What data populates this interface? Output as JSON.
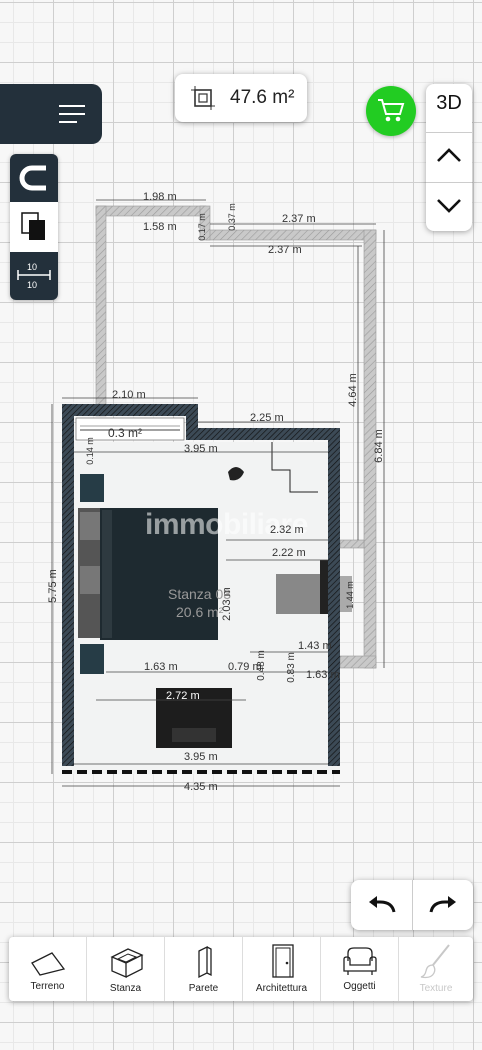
{
  "area": {
    "value": "47.6 m²"
  },
  "view": {
    "mode_label": "3D"
  },
  "plan": {
    "room_name": "Stanza 03",
    "room_area": "20.6 m²",
    "small_area": "0.3 m²",
    "watermark": "immobiliare",
    "dimensions": {
      "top_left_width": "1.98 m",
      "top_left_inner": "1.58 m",
      "top_right_width": "2.37 m",
      "top_right_inner": "2.37 m",
      "small_vertical_a": "0.17 m",
      "small_vertical_b": "0.37 m",
      "right_inner_height": "4.64 m",
      "right_outer_height": "6.84 m",
      "lower_left_width": "2.10 m",
      "lower_mid_width": "2.25 m",
      "room_top_inner": "3.95 m",
      "room_bottom_inner": "3.95 m",
      "room_outer_width": "4.35 m",
      "room_left_height": "5.75 m",
      "bed_right_a": "2.32 m",
      "bed_right_b": "2.22 m",
      "step_right": "1.43 m",
      "step_right_b": "1.63 m",
      "left_bottom_a": "1.63 m",
      "left_bottom_b": "0.79 m",
      "small_c": "0.83 m",
      "desk_width": "2.72 m",
      "window_small_a": "0.48 m",
      "window_small_b": "1.44 m",
      "left_small": "0.14 m",
      "vertical_mid": "2.03 m"
    }
  },
  "toolbar": {
    "items": [
      {
        "label": "Terreno",
        "icon": "terrain-icon"
      },
      {
        "label": "Stanza",
        "icon": "room-icon"
      },
      {
        "label": "Parete",
        "icon": "wall-icon"
      },
      {
        "label": "Architettura",
        "icon": "door-icon"
      },
      {
        "label": "Oggetti",
        "icon": "armchair-icon"
      },
      {
        "label": "Texture",
        "icon": "brush-icon"
      }
    ]
  },
  "colors": {
    "dark_panel": "#23303b",
    "cart_green": "#22cc22",
    "wall_gray": "#c9c9c9",
    "furniture_dark": "#1e2a30"
  }
}
